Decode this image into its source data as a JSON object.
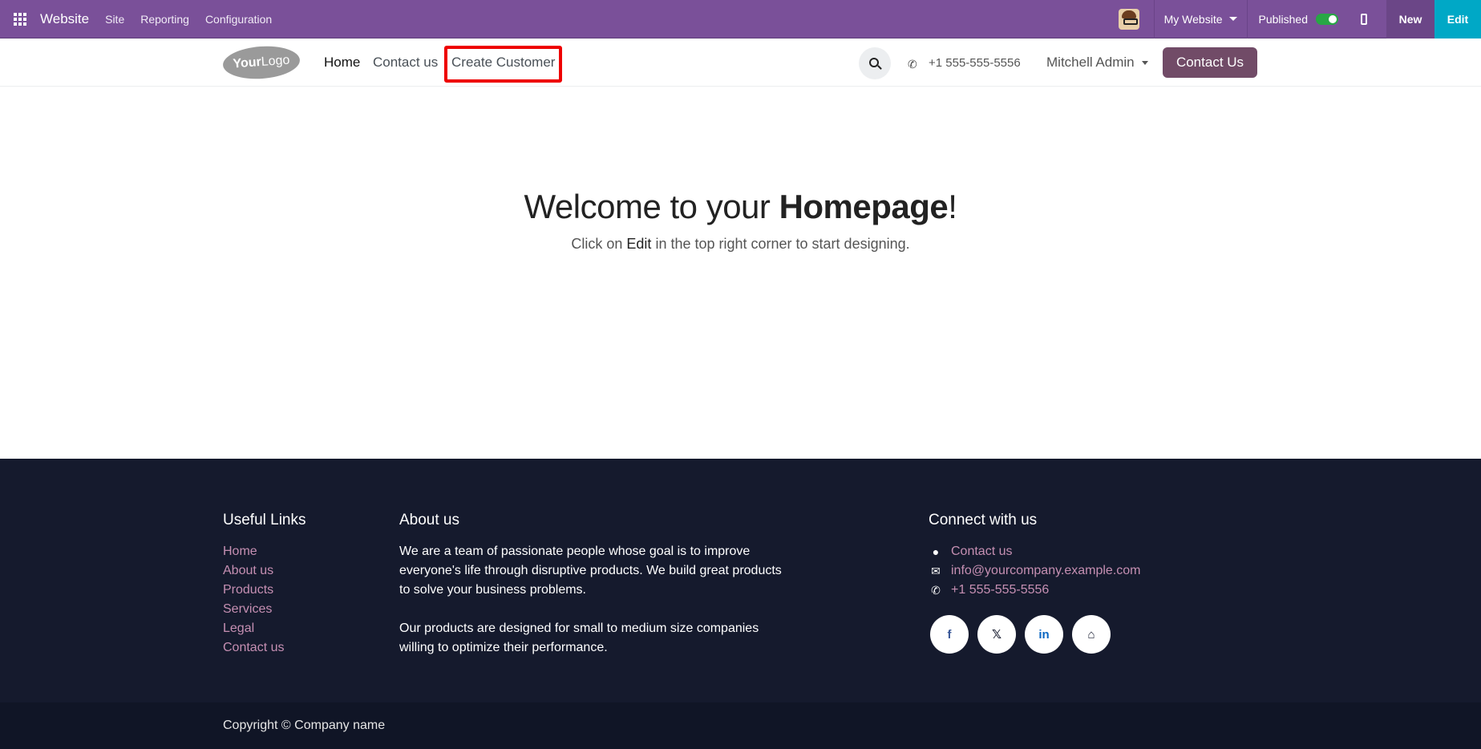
{
  "adminbar": {
    "app_name": "Website",
    "menus": [
      "Site",
      "Reporting",
      "Configuration"
    ],
    "website_selector": "My Website",
    "published_label": "Published",
    "new_label": "New",
    "edit_label": "Edit"
  },
  "header": {
    "logo_text_bold": "Your",
    "logo_text_light": "Logo",
    "nav": [
      "Home",
      "Contact us",
      "Create Customer"
    ],
    "phone": "+1 555-555-5556",
    "user": "Mitchell Admin",
    "cta": "Contact Us"
  },
  "hero": {
    "title_prefix": "Welcome to your ",
    "title_bold": "Homepage",
    "title_suffix": "!",
    "sub_prefix": "Click on ",
    "sub_edit": "Edit",
    "sub_suffix": " in the top right corner to start designing."
  },
  "footer": {
    "useful_links_title": "Useful Links",
    "useful_links": [
      "Home",
      "About us",
      "Products",
      "Services",
      "Legal",
      "Contact us"
    ],
    "about_title": "About us",
    "about_lines_1": [
      "We are a team of passionate people whose goal is to improve",
      "everyone's life through disruptive products. We build great products",
      "to solve your business problems."
    ],
    "about_lines_2": [
      "Our products are designed for small to medium size companies",
      "willing to optimize their performance."
    ],
    "connect_title": "Connect with us",
    "connect_contact": "Contact us",
    "connect_email": "info@yourcompany.example.com",
    "connect_phone": "+1 555-555-5556",
    "social": [
      "f",
      "𝕏",
      "in",
      "⌂"
    ],
    "copyright": "Copyright © Company name"
  },
  "colors": {
    "admin_bar": "#7a5099",
    "edit": "#00a8c6",
    "cta": "#714b67",
    "footer": "#151a2d",
    "footer_link": "#c58fb2",
    "highlight": "#ee0000"
  }
}
